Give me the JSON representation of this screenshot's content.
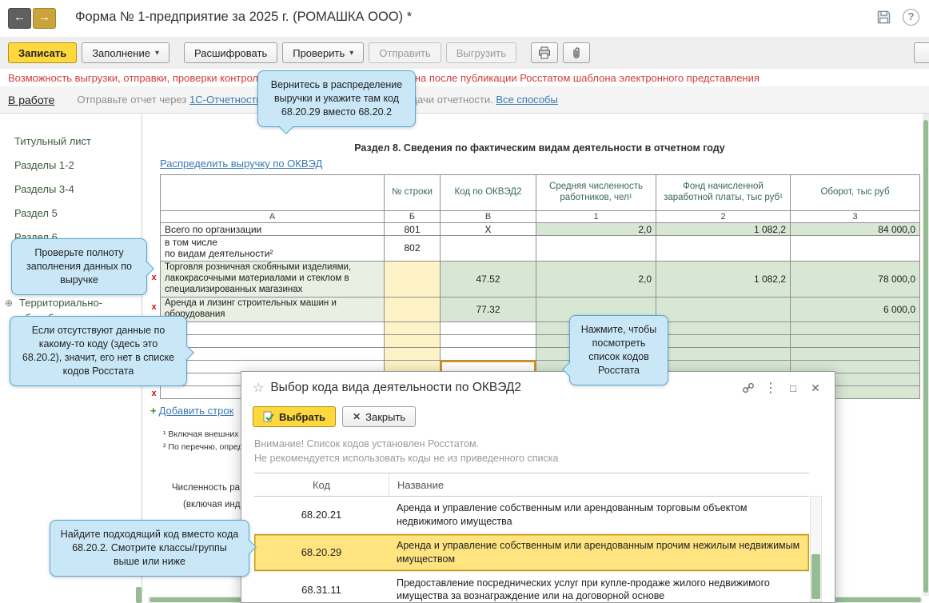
{
  "titlebar": {
    "title": "Форма № 1-предприятие за 2025 г. (РОМАШКА ООО) *"
  },
  "icons": {
    "back": "←",
    "forward": "→",
    "caret_down": "▾",
    "delete_row": "x",
    "add_plus": "+",
    "expand": "⊕",
    "star": "☆",
    "kebab": "⋮",
    "window_restore": "□",
    "close": "✕",
    "help": "?"
  },
  "toolbar": {
    "write": "Записать",
    "fill": "Заполнение",
    "decode": "Расшифровать",
    "check": "Проверить",
    "send": "Отправить",
    "export": "Выгрузить"
  },
  "warning": "Возможность выгрузки, отправки, проверки контрольных соотношений будет доступна после публикации Росстатом шаблона электронного представления",
  "status": {
    "state": "В работе",
    "before": "Отправьте отчет через",
    "link1": "1С-Отчетность",
    "middle": "или выберите другой способ сдачи отчетности.",
    "link2": "Все способы"
  },
  "sidebar": {
    "items": [
      "Титульный лист",
      "Разделы 1-2",
      "Разделы 3-4",
      "Раздел 5",
      "Раздел 6"
    ],
    "territorial": "Территориально-обособленные"
  },
  "section": {
    "title": "Раздел 8. Сведения по фактическим видам деятельности в отчетном году",
    "distribute_link": "Распределить выручку по ОКВЭД",
    "add_row": "Добавить строк",
    "footnote1": "¹ Включая внешних со",
    "footnote2": "² По перечню, опреде",
    "below1": "Численность ра",
    "below2": "(включая инди"
  },
  "table": {
    "headers": [
      "",
      "№ строки",
      "Код по ОКВЭД2",
      "Средняя численность работников, чел¹",
      "Фонд начисленной заработной платы, тыс руб¹",
      "Оборот, тыс руб"
    ],
    "letters": [
      "А",
      "Б",
      "В",
      "1",
      "2",
      "3"
    ],
    "rows": [
      {
        "a": "Всего по организации",
        "b": "801",
        "v": "Х",
        "c1": "2,0",
        "c2": "1 082,2",
        "c3": "84 000,0"
      },
      {
        "a": "в том числе\nпо видам деятельности²",
        "b": "802",
        "v": "",
        "c1": "",
        "c2": "",
        "c3": ""
      },
      {
        "a": "Торговля розничная скобяными изделиями, лакокрасочными материалами и стеклом в специализированных магазинах",
        "b": "",
        "v": "47.52",
        "c1": "2,0",
        "c2": "1 082,2",
        "c3": "78 000,0"
      },
      {
        "a": "Аренда и лизинг строительных машин и оборудования",
        "b": "",
        "v": "77.32",
        "c1": "",
        "c2": "",
        "c3": "6 000,0"
      },
      {
        "a": "",
        "b": "",
        "v": "",
        "c1": "",
        "c2": "",
        "c3": ""
      },
      {
        "a": "",
        "b": "",
        "v": "",
        "c1": "",
        "c2": "",
        "c3": ""
      },
      {
        "a": "",
        "b": "",
        "v": "",
        "c1": "",
        "c2": "",
        "c3": ""
      },
      {
        "a": "",
        "b": "",
        "v": "",
        "c1": "",
        "c2": "",
        "c3": ""
      },
      {
        "a": "",
        "b": "",
        "v": "",
        "c1": "",
        "c2": "",
        "c3": ""
      },
      {
        "a": "",
        "b": "",
        "v": "",
        "c1": "",
        "c2": "",
        "c3": ""
      }
    ]
  },
  "dialog": {
    "title": "Выбор кода вида деятельности по ОКВЭД2",
    "select_btn": "Выбрать",
    "close_btn": "Закрыть",
    "notice1": "Внимание! Список кодов установлен Росстатом.",
    "notice2": "Не рекомендуется использовать коды не из приведенного списка",
    "col_code": "Код",
    "col_name": "Название",
    "rows": [
      {
        "code": "68.20.21",
        "name": "Аренда и управление собственным или арендованным торговым объектом недвижимого имущества",
        "selected": false
      },
      {
        "code": "68.20.29",
        "name": "Аренда и управление собственным или арендованным прочим нежилым недвижимым имуществом",
        "selected": true
      },
      {
        "code": "68.31.11",
        "name": "Предоставление посреднических услуг при купле-продаже жилого недвижимого имущества за вознаграждение или на договорной основе",
        "selected": false
      }
    ]
  },
  "callouts": {
    "c1": "Вернитесь в распределение выручки и укажите там код 68.20.29 вместо 68.20.2",
    "c2": "Проверьте полноту заполнения данных по выручке",
    "c3": "Если отсутствуют данные по какому-то коду (здесь это 68.20.2), значит, его нет в списке кодов Росстата",
    "c4": "Нажмите, чтобы посмотреть список кодов Росстата",
    "c5": "Найдите подходящий код вместо кода 68.20.2. Смотрите классы/группы выше или ниже"
  },
  "colors": {
    "primary_button": "#FFD83D",
    "warning_text": "#D23B3B",
    "link": "#3978B5",
    "cell_green": "#D8E7D4",
    "cell_yellow": "#FDF3C6",
    "selected_cell_border": "#E59400",
    "selected_row_bg": "#FFE480",
    "callout_bg": "#C9E7F6",
    "callout_border": "#56A7D3",
    "scroll_thumb": "#94BD94",
    "delete_mark": "#CC1111"
  }
}
